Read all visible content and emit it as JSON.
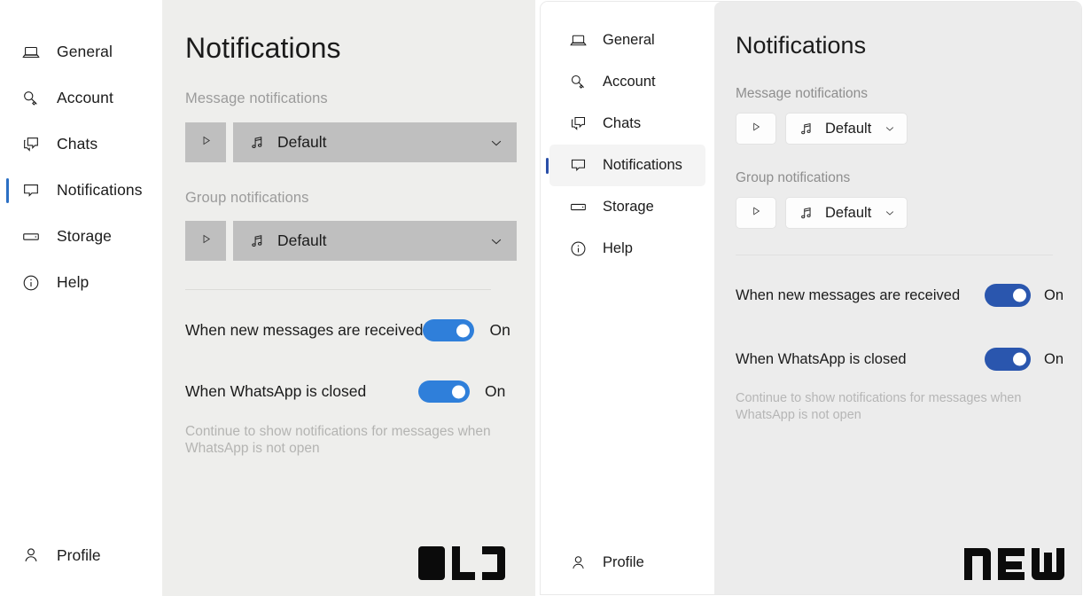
{
  "comparison": {
    "old_badge": "OLD",
    "new_badge": "NEW"
  },
  "old_window": {
    "sidebar": {
      "items": [
        {
          "label": "General",
          "icon": "laptop-icon",
          "selected": false
        },
        {
          "label": "Account",
          "icon": "key-icon",
          "selected": false
        },
        {
          "label": "Chats",
          "icon": "chat-bubbles-icon",
          "selected": false
        },
        {
          "label": "Notifications",
          "icon": "notification-bubble-icon",
          "selected": true
        },
        {
          "label": "Storage",
          "icon": "storage-drive-icon",
          "selected": false
        },
        {
          "label": "Help",
          "icon": "info-circle-icon",
          "selected": false
        }
      ],
      "profile": {
        "label": "Profile",
        "icon": "person-icon"
      }
    },
    "main": {
      "title": "Notifications",
      "message_section_label": "Message notifications",
      "message_sound": {
        "value": "Default",
        "play_label": "play-icon"
      },
      "group_section_label": "Group notifications",
      "group_sound": {
        "value": "Default",
        "play_label": "play-icon"
      },
      "toggles": [
        {
          "label": "When new messages are received",
          "state": "On"
        },
        {
          "label": "When WhatsApp is closed",
          "state": "On"
        }
      ],
      "hint": "Continue to show notifications for messages when WhatsApp is not open"
    },
    "colors": {
      "accent": "#2f7fda",
      "pane_bg": "#eeeeec",
      "control_bg": "#bfbfbf"
    }
  },
  "new_window": {
    "sidebar": {
      "items": [
        {
          "label": "General",
          "icon": "laptop-icon",
          "selected": false
        },
        {
          "label": "Account",
          "icon": "key-icon",
          "selected": false
        },
        {
          "label": "Chats",
          "icon": "chat-bubbles-icon",
          "selected": false
        },
        {
          "label": "Notifications",
          "icon": "notification-bubble-icon",
          "selected": true
        },
        {
          "label": "Storage",
          "icon": "storage-drive-icon",
          "selected": false
        },
        {
          "label": "Help",
          "icon": "info-circle-icon",
          "selected": false
        }
      ],
      "profile": {
        "label": "Profile",
        "icon": "person-icon"
      }
    },
    "main": {
      "title": "Notifications",
      "message_section_label": "Message notifications",
      "message_sound": {
        "value": "Default",
        "play_label": "play-icon"
      },
      "group_section_label": "Group notifications",
      "group_sound": {
        "value": "Default",
        "play_label": "play-icon"
      },
      "toggles": [
        {
          "label": "When new messages are received",
          "state": "On"
        },
        {
          "label": "When WhatsApp is closed",
          "state": "On"
        }
      ],
      "hint": "Continue to show notifications for messages when WhatsApp is not open"
    },
    "colors": {
      "accent": "#2a56ae",
      "pane_bg": "#ececec",
      "control_bg": "#fdfdfd"
    }
  }
}
